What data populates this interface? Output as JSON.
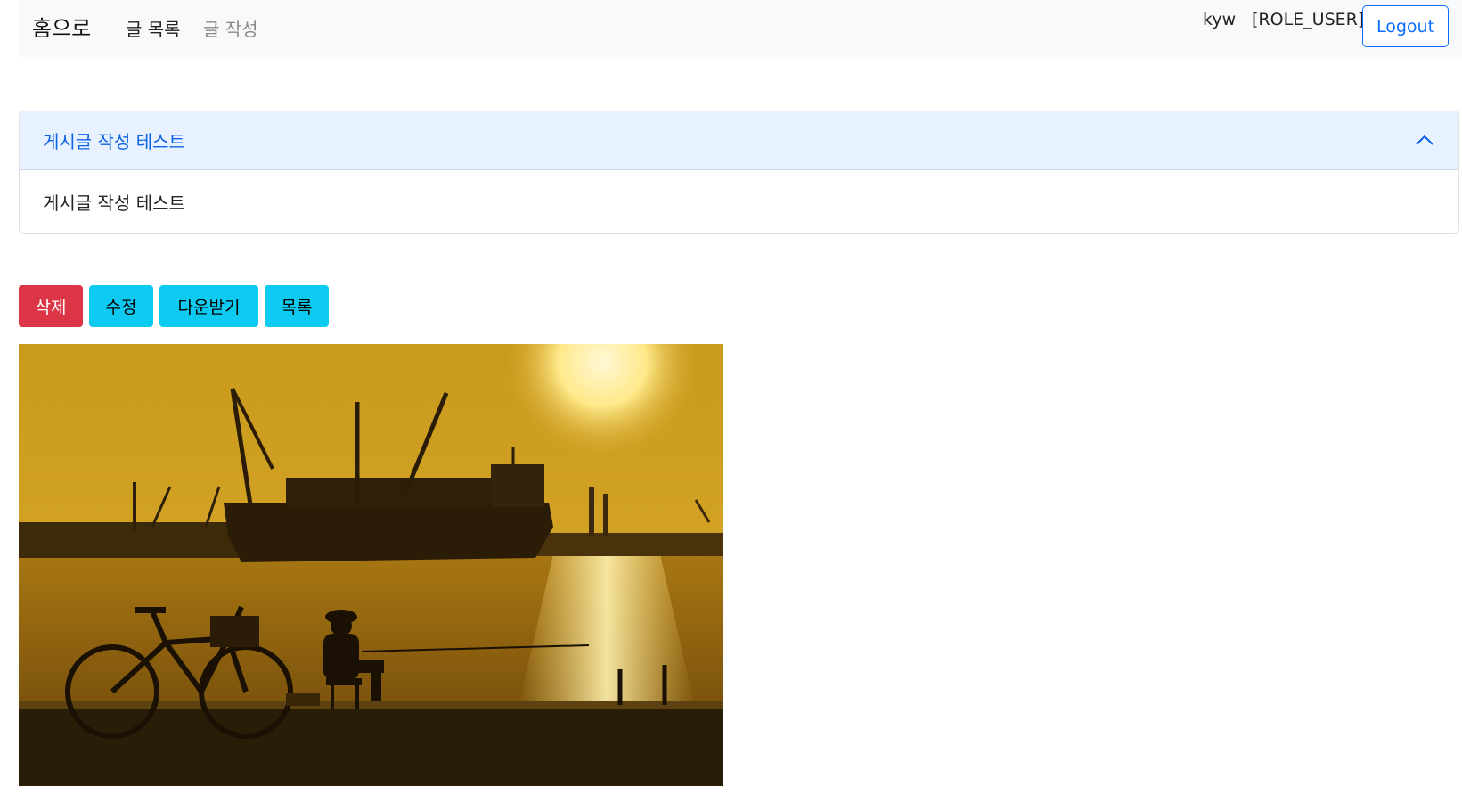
{
  "nav": {
    "brand": "홈으로",
    "links": [
      "글 목록",
      "글 작성"
    ],
    "user_name": "kyw",
    "user_role": "[ROLE_USER]",
    "logout_label": "Logout"
  },
  "post": {
    "title": "게시글 작성 테스트",
    "body": "게시글 작성 테스트",
    "expanded": true
  },
  "actions": {
    "delete_label": "삭제",
    "edit_label": "수정",
    "download_label": "다운받기",
    "list_label": "목록"
  },
  "colors": {
    "primary": "#0d6efd",
    "danger": "#dc3545",
    "info": "#0dcaf0",
    "navbar_bg": "#f8f9fa",
    "accordion_header_bg": "#e7f1ff"
  },
  "icons": {
    "accordion_toggle": "chevron-up-icon"
  }
}
